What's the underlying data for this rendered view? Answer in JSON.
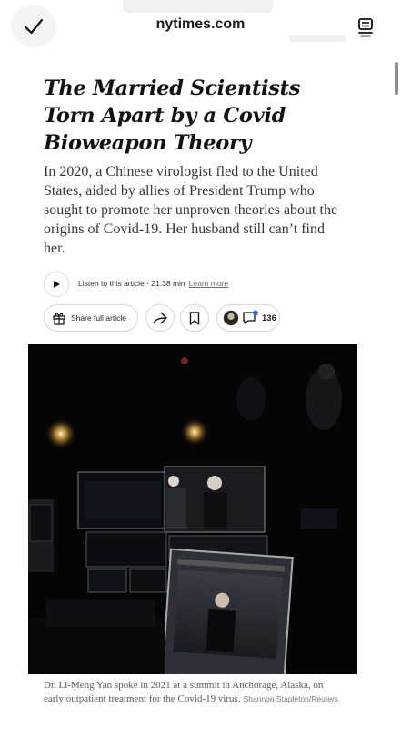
{
  "browser": {
    "domain": "nytimes.com"
  },
  "article": {
    "headline": "The Married Scientists Torn Apart by a Covid Bioweapon Theory",
    "summary": "In 2020, a Chinese virologist fled to the United States, aided by allies of President Trump who sought to promote her unproven theories about the origins of Covid-19. Her husband still can’t find her.",
    "listen_label": "Listen to this article · 21:38 min",
    "learn_more": "Learn more",
    "share_label": "Share full article",
    "comment_count": "136"
  },
  "photo": {
    "caption": "Dr. Li-Meng Yan spoke in 2021 at a summit in Anchorage, Alaska, on early outpatient treatment for the Covid-19 virus.",
    "credit": "Shannon Stapleton/Reuters"
  },
  "colors": {
    "text": "#121212",
    "comment_badge": "#2f6fed",
    "photo_background": "#050506"
  }
}
